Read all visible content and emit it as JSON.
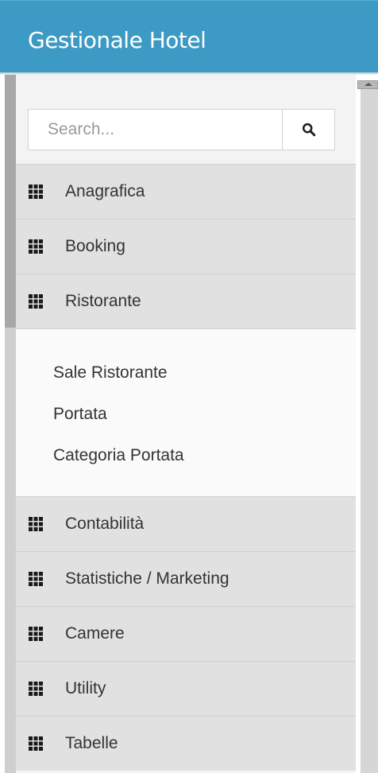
{
  "app": {
    "title": "Gestionale Hotel"
  },
  "search": {
    "placeholder": "Search...",
    "value": ""
  },
  "menu": {
    "items": [
      {
        "label": "Anagrafica",
        "icon": "grid-icon"
      },
      {
        "label": "Booking",
        "icon": "grid-icon"
      },
      {
        "label": "Ristorante",
        "icon": "grid-icon",
        "expanded": true
      },
      {
        "label": "Contabilità",
        "icon": "grid-icon"
      },
      {
        "label": "Statistiche / Marketing",
        "icon": "grid-icon"
      },
      {
        "label": "Camere",
        "icon": "grid-icon"
      },
      {
        "label": "Utility",
        "icon": "grid-icon"
      },
      {
        "label": "Tabelle",
        "icon": "grid-icon"
      }
    ],
    "submenu": [
      {
        "label": "Sale Ristorante"
      },
      {
        "label": "Portata"
      },
      {
        "label": "Categoria Portata"
      }
    ]
  },
  "colors": {
    "header": "#3c9ac5",
    "menu_item_bg": "#e1e1e1",
    "submenu_bg": "#fafafa",
    "sidebar_bg": "#f3f3f3"
  }
}
